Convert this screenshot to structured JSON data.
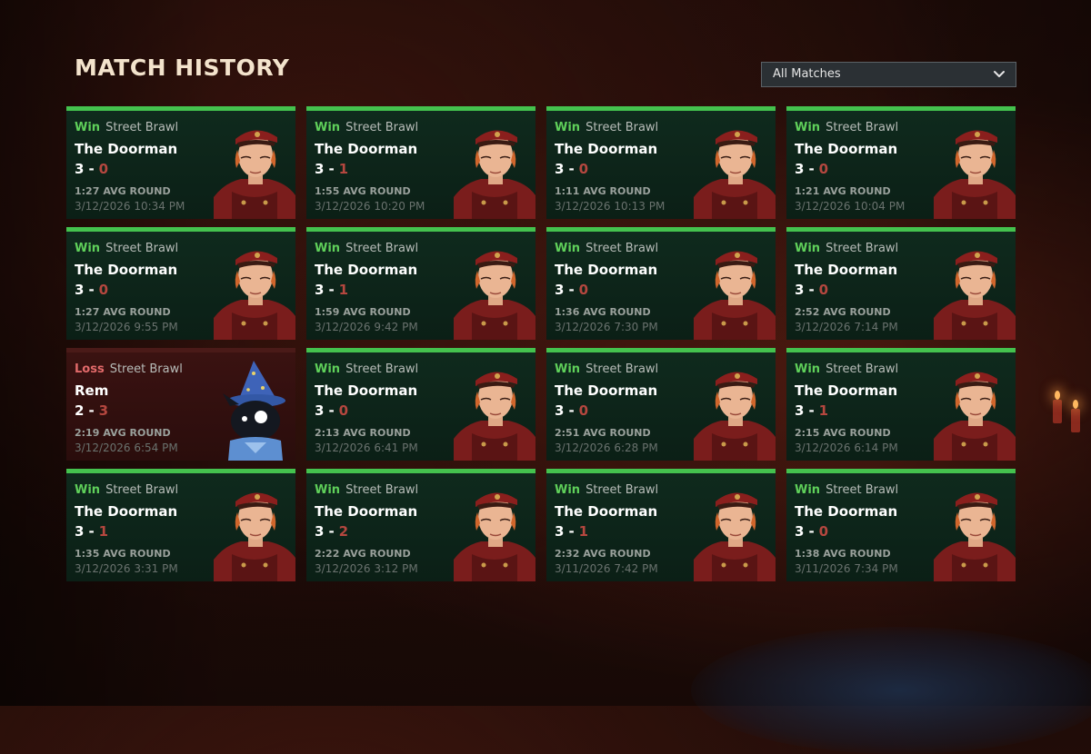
{
  "page": {
    "title": "MATCH HISTORY"
  },
  "filter": {
    "selected": "All Matches"
  },
  "labels": {
    "avg_round": "AVG ROUND"
  },
  "matches": [
    {
      "result": "Win",
      "mode": "Street Brawl",
      "hero": "The Doorman",
      "score": "3",
      "opp": "0",
      "avg": "1:27",
      "date": "3/12/2026 10:34 PM"
    },
    {
      "result": "Win",
      "mode": "Street Brawl",
      "hero": "The Doorman",
      "score": "3",
      "opp": "1",
      "avg": "1:55",
      "date": "3/12/2026 10:20 PM"
    },
    {
      "result": "Win",
      "mode": "Street Brawl",
      "hero": "The Doorman",
      "score": "3",
      "opp": "0",
      "avg": "1:11",
      "date": "3/12/2026 10:13 PM"
    },
    {
      "result": "Win",
      "mode": "Street Brawl",
      "hero": "The Doorman",
      "score": "3",
      "opp": "0",
      "avg": "1:21",
      "date": "3/12/2026 10:04 PM"
    },
    {
      "result": "Win",
      "mode": "Street Brawl",
      "hero": "The Doorman",
      "score": "3",
      "opp": "0",
      "avg": "1:27",
      "date": "3/12/2026 9:55 PM"
    },
    {
      "result": "Win",
      "mode": "Street Brawl",
      "hero": "The Doorman",
      "score": "3",
      "opp": "1",
      "avg": "1:59",
      "date": "3/12/2026 9:42 PM"
    },
    {
      "result": "Win",
      "mode": "Street Brawl",
      "hero": "The Doorman",
      "score": "3",
      "opp": "0",
      "avg": "1:36",
      "date": "3/12/2026 7:30 PM"
    },
    {
      "result": "Win",
      "mode": "Street Brawl",
      "hero": "The Doorman",
      "score": "3",
      "opp": "0",
      "avg": "2:52",
      "date": "3/12/2026 7:14 PM"
    },
    {
      "result": "Loss",
      "mode": "Street Brawl",
      "hero": "Rem",
      "score": "2",
      "opp": "3",
      "avg": "2:19",
      "date": "3/12/2026 6:54 PM"
    },
    {
      "result": "Win",
      "mode": "Street Brawl",
      "hero": "The Doorman",
      "score": "3",
      "opp": "0",
      "avg": "2:13",
      "date": "3/12/2026 6:41 PM"
    },
    {
      "result": "Win",
      "mode": "Street Brawl",
      "hero": "The Doorman",
      "score": "3",
      "opp": "0",
      "avg": "2:51",
      "date": "3/12/2026 6:28 PM"
    },
    {
      "result": "Win",
      "mode": "Street Brawl",
      "hero": "The Doorman",
      "score": "3",
      "opp": "1",
      "avg": "2:15",
      "date": "3/12/2026 6:14 PM"
    },
    {
      "result": "Win",
      "mode": "Street Brawl",
      "hero": "The Doorman",
      "score": "3",
      "opp": "1",
      "avg": "1:35",
      "date": "3/12/2026 3:31 PM"
    },
    {
      "result": "Win",
      "mode": "Street Brawl",
      "hero": "The Doorman",
      "score": "3",
      "opp": "2",
      "avg": "2:22",
      "date": "3/12/2026 3:12 PM"
    },
    {
      "result": "Win",
      "mode": "Street Brawl",
      "hero": "The Doorman",
      "score": "3",
      "opp": "1",
      "avg": "2:32",
      "date": "3/11/2026 7:42 PM"
    },
    {
      "result": "Win",
      "mode": "Street Brawl",
      "hero": "The Doorman",
      "score": "3",
      "opp": "0",
      "avg": "1:38",
      "date": "3/11/2026 7:34 PM"
    }
  ],
  "colors": {
    "win": "#5fd05a",
    "loss": "#e26a6a",
    "win_bar": "#44c24e",
    "opp_score": "#b5473f"
  },
  "icons": {
    "filter_chevron": "chevron-down-icon"
  }
}
